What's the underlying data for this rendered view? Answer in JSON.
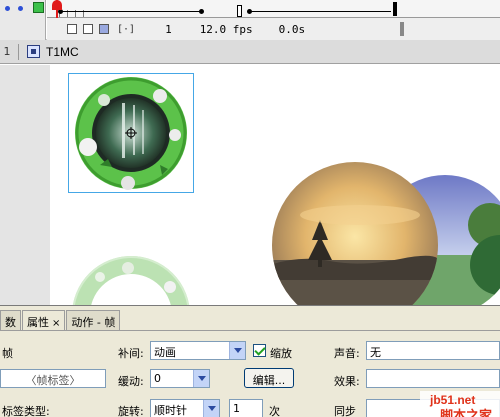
{
  "timeline": {
    "current_frame": "1",
    "fps": "12.0 fps",
    "elapsed_time": "0.0s"
  },
  "edit_bar": {
    "scene_number": "1",
    "symbol_name": "T1MC"
  },
  "stage": {
    "objects": [
      {
        "name": "ring-with-waterfall",
        "selected": true
      },
      {
        "name": "ring-outline-faded",
        "selected": false
      },
      {
        "name": "sunset-circle",
        "selected": false
      },
      {
        "name": "sky-circle",
        "selected": false
      }
    ]
  },
  "panel": {
    "tabs": [
      {
        "label": "数",
        "active": false
      },
      {
        "label": "属性",
        "active": true
      },
      {
        "label": "动作 - 帧",
        "active": false
      }
    ],
    "tab_close": "×",
    "frame_label": "帧",
    "frame_name_placeholder": "〈帧标签〉",
    "label_type_label": "标签类型:",
    "tween_label": "补间:",
    "tween_value": "动画",
    "scale_label": "缩放",
    "scale_checked": true,
    "ease_label": "缓动:",
    "ease_value": "0",
    "edit_button": "编辑...",
    "rotate_label": "旋转:",
    "rotate_value": "顺时针",
    "rotate_count": "1",
    "rotate_unit": "次",
    "sound_label": "声音:",
    "sound_value": "无",
    "effect_label": "效果:",
    "sync_label": "同步"
  },
  "watermark": {
    "site": "jb51.net",
    "brand": "脚本之家"
  },
  "colors": {
    "ring_green": "#5cc24a",
    "selection": "#45a7e6",
    "panel_bg": "#ece9d8",
    "playhead": "#e01b1b"
  }
}
